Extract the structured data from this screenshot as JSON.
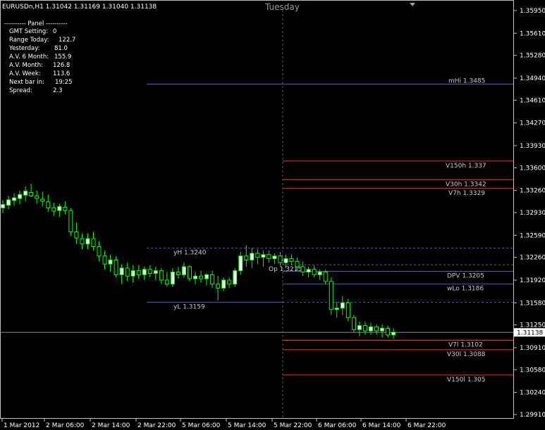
{
  "header": {
    "symbol_line": "EURUSDn,H1  1.31042 1.31169 1.31040 1.31138",
    "day_label": "Tuesday"
  },
  "panel": {
    "title": "----------  Panel  ----------",
    "rows": [
      {
        "label": "GMT Setting:",
        "value": "0"
      },
      {
        "label": "Range Today:",
        "value": "122.7"
      },
      {
        "label": "Yesterday:",
        "value": "81.0"
      },
      {
        "label": "A.V. 6 Month:",
        "value": "155.9"
      },
      {
        "label": "A.V. Month:",
        "value": "126.8"
      },
      {
        "label": "A.V. Week:",
        "value": "113.6"
      },
      {
        "label": "Next bar in:",
        "value": "19:25"
      },
      {
        "label": "Spread:",
        "value": "2.3"
      }
    ]
  },
  "current_price": "1.31138",
  "colors": {
    "background": "#000000",
    "candle_up": "#ffffff",
    "candle_down": "#000000",
    "candle_outline": "#00ff00",
    "resistance_line": "#ff3030",
    "blue_line": "#5a5ab8",
    "grid_dashed": "#555555"
  },
  "chart_data": {
    "type": "candlestick",
    "symbol": "EURUSDn",
    "timeframe": "H1",
    "ylim": [
      1.3014,
      1.3612
    ],
    "y_ticks": [
      "1.35950",
      "1.35610",
      "1.35280",
      "1.34940",
      "1.34610",
      "1.34270",
      "1.33930",
      "1.33600",
      "1.33260",
      "1.32930",
      "1.32590",
      "1.32260",
      "1.31920",
      "1.31580",
      "1.31250",
      "1.30910",
      "1.30580",
      "1.30240",
      "1.29910"
    ],
    "x_ticks": [
      "1 Mar 2012",
      "2 Mar 06:00",
      "2 Mar 14:00",
      "2 Mar 22:00",
      "5 Mar 06:00",
      "5 Mar 14:00",
      "5 Mar 22:00",
      "6 Mar 06:00",
      "6 Mar 14:00",
      "6 Mar 22:00"
    ],
    "levels": [
      {
        "label": "mHi 1.3485",
        "value": 1.3485,
        "color": "blue"
      },
      {
        "label": "V150h 1.337",
        "value": 1.337,
        "color": "red"
      },
      {
        "label": "V30h 1.3342",
        "value": 1.3342,
        "color": "red"
      },
      {
        "label": "V7h 1.3329",
        "value": 1.3329,
        "color": "red"
      },
      {
        "label": "yH 1.3240",
        "value": 1.324,
        "color": "blue-dashed"
      },
      {
        "label": "Op 1.3215",
        "value": 1.3215,
        "color": "blue-dashed"
      },
      {
        "label": "DPV 1.3205",
        "value": 1.3205,
        "color": "blue"
      },
      {
        "label": "wLo 1.3186",
        "value": 1.3186,
        "color": "blue"
      },
      {
        "label": "yL 1.3159",
        "value": 1.3159,
        "color": "blue"
      },
      {
        "label": "V7l 1.3102",
        "value": 1.3102,
        "color": "red"
      },
      {
        "label": "V30l 1.3088",
        "value": 1.3088,
        "color": "red"
      },
      {
        "label": "V150l 1.305",
        "value": 1.305,
        "color": "red"
      }
    ],
    "candles": [
      [
        1.33,
        1.3312,
        1.3292,
        1.3305
      ],
      [
        1.3304,
        1.3318,
        1.3298,
        1.3312
      ],
      [
        1.3311,
        1.3322,
        1.3303,
        1.3315
      ],
      [
        1.3314,
        1.3326,
        1.3305,
        1.332
      ],
      [
        1.3319,
        1.3332,
        1.331,
        1.3325
      ],
      [
        1.3323,
        1.3336,
        1.3316,
        1.3318
      ],
      [
        1.3318,
        1.3326,
        1.3306,
        1.3314
      ],
      [
        1.3313,
        1.3324,
        1.3302,
        1.331
      ],
      [
        1.3309,
        1.332,
        1.3294,
        1.33
      ],
      [
        1.33,
        1.3308,
        1.3288,
        1.3295
      ],
      [
        1.3296,
        1.3306,
        1.3286,
        1.3302
      ],
      [
        1.3301,
        1.331,
        1.329,
        1.3296
      ],
      [
        1.3296,
        1.33,
        1.3258,
        1.3264
      ],
      [
        1.3264,
        1.3278,
        1.3246,
        1.3255
      ],
      [
        1.3254,
        1.3262,
        1.3238,
        1.3246
      ],
      [
        1.3246,
        1.3262,
        1.3238,
        1.3254
      ],
      [
        1.3254,
        1.3264,
        1.3236,
        1.3242
      ],
      [
        1.3242,
        1.325,
        1.322,
        1.3228
      ],
      [
        1.3228,
        1.3236,
        1.3208,
        1.3216
      ],
      [
        1.3216,
        1.323,
        1.3204,
        1.3222
      ],
      [
        1.3222,
        1.3228,
        1.3196,
        1.32
      ],
      [
        1.32,
        1.3216,
        1.3186,
        1.321
      ],
      [
        1.321,
        1.3218,
        1.319,
        1.3198
      ],
      [
        1.3198,
        1.3214,
        1.3188,
        1.3206
      ],
      [
        1.3206,
        1.3214,
        1.3194,
        1.32
      ],
      [
        1.32,
        1.3212,
        1.3192,
        1.3208
      ],
      [
        1.3208,
        1.3214,
        1.3196,
        1.3202
      ],
      [
        1.3202,
        1.3212,
        1.3192,
        1.3206
      ],
      [
        1.3206,
        1.321,
        1.3186,
        1.3192
      ],
      [
        1.3192,
        1.3204,
        1.3182,
        1.3186
      ],
      [
        1.3186,
        1.321,
        1.3182,
        1.3204
      ],
      [
        1.3204,
        1.3212,
        1.3194,
        1.32
      ],
      [
        1.32,
        1.3218,
        1.3196,
        1.3212
      ],
      [
        1.3212,
        1.3214,
        1.319,
        1.3194
      ],
      [
        1.3194,
        1.3204,
        1.3186,
        1.3198
      ],
      [
        1.3198,
        1.3206,
        1.3188,
        1.3194
      ],
      [
        1.3194,
        1.3202,
        1.3184,
        1.32
      ],
      [
        1.32,
        1.3206,
        1.318,
        1.3186
      ],
      [
        1.3186,
        1.3198,
        1.3162,
        1.318
      ],
      [
        1.318,
        1.3196,
        1.3176,
        1.3192
      ],
      [
        1.3192,
        1.3196,
        1.318,
        1.3186
      ],
      [
        1.3186,
        1.321,
        1.3182,
        1.3206
      ],
      [
        1.3206,
        1.3234,
        1.32,
        1.3228
      ],
      [
        1.3228,
        1.3244,
        1.3212,
        1.3222
      ],
      [
        1.3222,
        1.324,
        1.321,
        1.3232
      ],
      [
        1.3232,
        1.3238,
        1.3216,
        1.3226
      ],
      [
        1.3226,
        1.3236,
        1.3212,
        1.323
      ],
      [
        1.323,
        1.3236,
        1.3218,
        1.3224
      ],
      [
        1.3224,
        1.3232,
        1.3216,
        1.3228
      ],
      [
        1.3228,
        1.3234,
        1.3212,
        1.3218
      ],
      [
        1.3218,
        1.323,
        1.321,
        1.3224
      ],
      [
        1.3224,
        1.323,
        1.3214,
        1.322
      ],
      [
        1.322,
        1.3226,
        1.3206,
        1.3212
      ],
      [
        1.3212,
        1.322,
        1.3198,
        1.3204
      ],
      [
        1.3204,
        1.3212,
        1.3196,
        1.3208
      ],
      [
        1.3208,
        1.3214,
        1.3196,
        1.32
      ],
      [
        1.32,
        1.3208,
        1.3192,
        1.3204
      ],
      [
        1.3204,
        1.3208,
        1.3186,
        1.319
      ],
      [
        1.319,
        1.3196,
        1.314,
        1.3148
      ],
      [
        1.3148,
        1.316,
        1.3136,
        1.315
      ],
      [
        1.315,
        1.3168,
        1.314,
        1.3158
      ],
      [
        1.3158,
        1.3164,
        1.313,
        1.3136
      ],
      [
        1.3136,
        1.314,
        1.3114,
        1.3118
      ],
      [
        1.3118,
        1.313,
        1.3108,
        1.3124
      ],
      [
        1.3124,
        1.313,
        1.311,
        1.3116
      ],
      [
        1.3116,
        1.3128,
        1.311,
        1.3122
      ],
      [
        1.3122,
        1.3126,
        1.311,
        1.3116
      ],
      [
        1.3116,
        1.3126,
        1.3106,
        1.312
      ],
      [
        1.312,
        1.3124,
        1.3106,
        1.311
      ],
      [
        1.311,
        1.312,
        1.3104,
        1.3114
      ]
    ]
  }
}
